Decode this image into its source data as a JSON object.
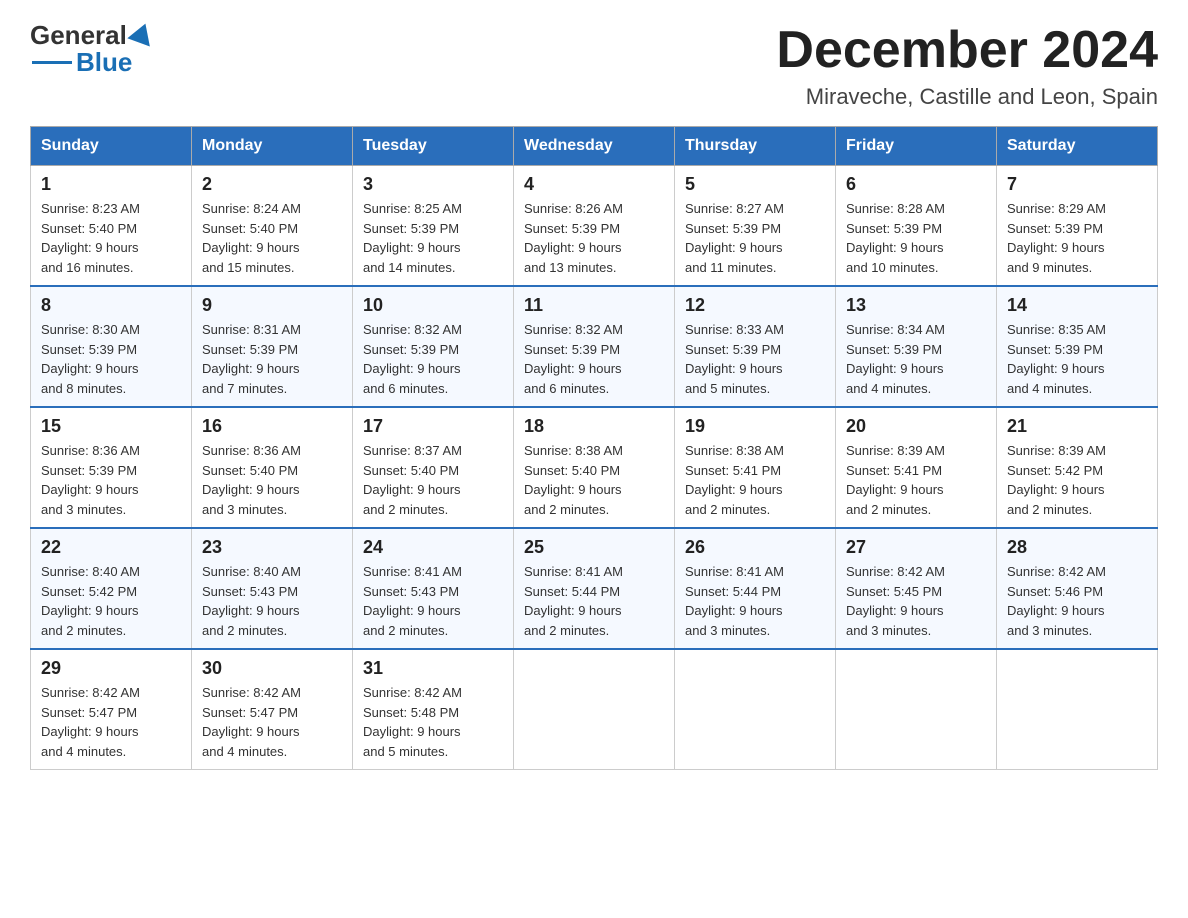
{
  "header": {
    "logo_general": "General",
    "logo_blue": "Blue",
    "month_title": "December 2024",
    "location": "Miraveche, Castille and Leon, Spain"
  },
  "weekdays": [
    "Sunday",
    "Monday",
    "Tuesday",
    "Wednesday",
    "Thursday",
    "Friday",
    "Saturday"
  ],
  "weeks": [
    [
      {
        "day": "1",
        "sunrise": "8:23 AM",
        "sunset": "5:40 PM",
        "daylight": "9 hours and 16 minutes."
      },
      {
        "day": "2",
        "sunrise": "8:24 AM",
        "sunset": "5:40 PM",
        "daylight": "9 hours and 15 minutes."
      },
      {
        "day": "3",
        "sunrise": "8:25 AM",
        "sunset": "5:39 PM",
        "daylight": "9 hours and 14 minutes."
      },
      {
        "day": "4",
        "sunrise": "8:26 AM",
        "sunset": "5:39 PM",
        "daylight": "9 hours and 13 minutes."
      },
      {
        "day": "5",
        "sunrise": "8:27 AM",
        "sunset": "5:39 PM",
        "daylight": "9 hours and 11 minutes."
      },
      {
        "day": "6",
        "sunrise": "8:28 AM",
        "sunset": "5:39 PM",
        "daylight": "9 hours and 10 minutes."
      },
      {
        "day": "7",
        "sunrise": "8:29 AM",
        "sunset": "5:39 PM",
        "daylight": "9 hours and 9 minutes."
      }
    ],
    [
      {
        "day": "8",
        "sunrise": "8:30 AM",
        "sunset": "5:39 PM",
        "daylight": "9 hours and 8 minutes."
      },
      {
        "day": "9",
        "sunrise": "8:31 AM",
        "sunset": "5:39 PM",
        "daylight": "9 hours and 7 minutes."
      },
      {
        "day": "10",
        "sunrise": "8:32 AM",
        "sunset": "5:39 PM",
        "daylight": "9 hours and 6 minutes."
      },
      {
        "day": "11",
        "sunrise": "8:32 AM",
        "sunset": "5:39 PM",
        "daylight": "9 hours and 6 minutes."
      },
      {
        "day": "12",
        "sunrise": "8:33 AM",
        "sunset": "5:39 PM",
        "daylight": "9 hours and 5 minutes."
      },
      {
        "day": "13",
        "sunrise": "8:34 AM",
        "sunset": "5:39 PM",
        "daylight": "9 hours and 4 minutes."
      },
      {
        "day": "14",
        "sunrise": "8:35 AM",
        "sunset": "5:39 PM",
        "daylight": "9 hours and 4 minutes."
      }
    ],
    [
      {
        "day": "15",
        "sunrise": "8:36 AM",
        "sunset": "5:39 PM",
        "daylight": "9 hours and 3 minutes."
      },
      {
        "day": "16",
        "sunrise": "8:36 AM",
        "sunset": "5:40 PM",
        "daylight": "9 hours and 3 minutes."
      },
      {
        "day": "17",
        "sunrise": "8:37 AM",
        "sunset": "5:40 PM",
        "daylight": "9 hours and 2 minutes."
      },
      {
        "day": "18",
        "sunrise": "8:38 AM",
        "sunset": "5:40 PM",
        "daylight": "9 hours and 2 minutes."
      },
      {
        "day": "19",
        "sunrise": "8:38 AM",
        "sunset": "5:41 PM",
        "daylight": "9 hours and 2 minutes."
      },
      {
        "day": "20",
        "sunrise": "8:39 AM",
        "sunset": "5:41 PM",
        "daylight": "9 hours and 2 minutes."
      },
      {
        "day": "21",
        "sunrise": "8:39 AM",
        "sunset": "5:42 PM",
        "daylight": "9 hours and 2 minutes."
      }
    ],
    [
      {
        "day": "22",
        "sunrise": "8:40 AM",
        "sunset": "5:42 PM",
        "daylight": "9 hours and 2 minutes."
      },
      {
        "day": "23",
        "sunrise": "8:40 AM",
        "sunset": "5:43 PM",
        "daylight": "9 hours and 2 minutes."
      },
      {
        "day": "24",
        "sunrise": "8:41 AM",
        "sunset": "5:43 PM",
        "daylight": "9 hours and 2 minutes."
      },
      {
        "day": "25",
        "sunrise": "8:41 AM",
        "sunset": "5:44 PM",
        "daylight": "9 hours and 2 minutes."
      },
      {
        "day": "26",
        "sunrise": "8:41 AM",
        "sunset": "5:44 PM",
        "daylight": "9 hours and 3 minutes."
      },
      {
        "day": "27",
        "sunrise": "8:42 AM",
        "sunset": "5:45 PM",
        "daylight": "9 hours and 3 minutes."
      },
      {
        "day": "28",
        "sunrise": "8:42 AM",
        "sunset": "5:46 PM",
        "daylight": "9 hours and 3 minutes."
      }
    ],
    [
      {
        "day": "29",
        "sunrise": "8:42 AM",
        "sunset": "5:47 PM",
        "daylight": "9 hours and 4 minutes."
      },
      {
        "day": "30",
        "sunrise": "8:42 AM",
        "sunset": "5:47 PM",
        "daylight": "9 hours and 4 minutes."
      },
      {
        "day": "31",
        "sunrise": "8:42 AM",
        "sunset": "5:48 PM",
        "daylight": "9 hours and 5 minutes."
      },
      null,
      null,
      null,
      null
    ]
  ],
  "labels": {
    "sunrise": "Sunrise:",
    "sunset": "Sunset:",
    "daylight": "Daylight:"
  }
}
